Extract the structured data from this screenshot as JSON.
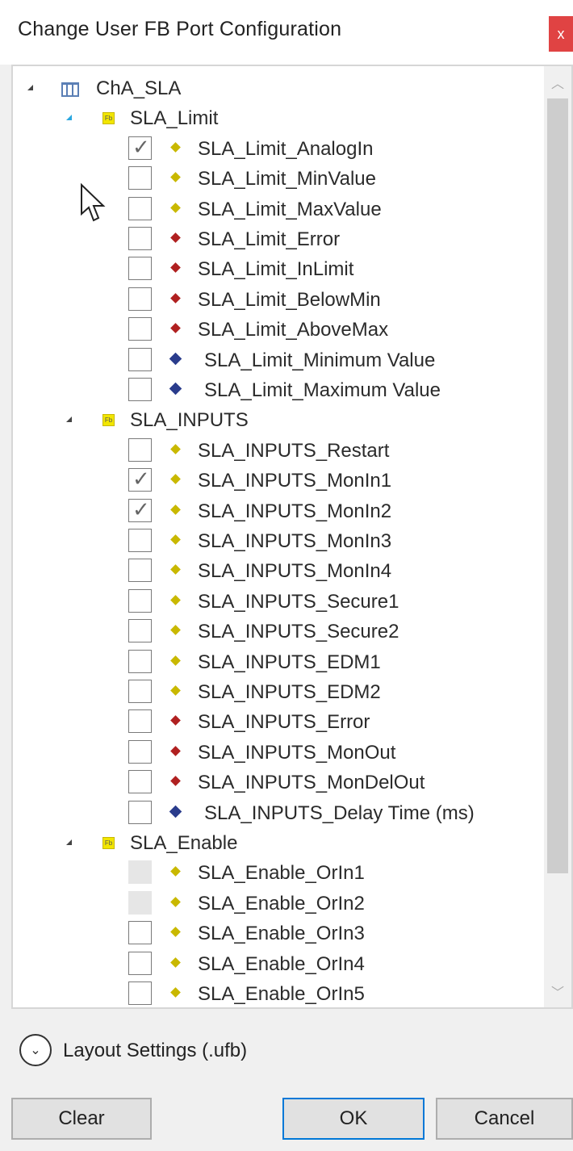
{
  "window": {
    "title": "Change User FB Port Configuration",
    "close_label": "x"
  },
  "tree": {
    "root": {
      "label": "ChA_SLA",
      "icon": "fb-table-icon"
    },
    "groups": [
      {
        "label": "SLA_Limit",
        "icon": "fb-icon",
        "items": [
          {
            "label": "SLA_Limit_AnalogIn",
            "checked": true,
            "disabled": false,
            "color": "#c9b800"
          },
          {
            "label": "SLA_Limit_MinValue",
            "checked": false,
            "disabled": false,
            "color": "#c9b800"
          },
          {
            "label": "SLA_Limit_MaxValue",
            "checked": false,
            "disabled": false,
            "color": "#c9b800"
          },
          {
            "label": "SLA_Limit_Error",
            "checked": false,
            "disabled": false,
            "color": "#b02020"
          },
          {
            "label": "SLA_Limit_InLimit",
            "checked": false,
            "disabled": false,
            "color": "#b02020"
          },
          {
            "label": "SLA_Limit_BelowMin",
            "checked": false,
            "disabled": false,
            "color": "#b02020"
          },
          {
            "label": "SLA_Limit_AboveMax",
            "checked": false,
            "disabled": false,
            "color": "#b02020"
          },
          {
            "label": "SLA_Limit_Minimum Value",
            "checked": false,
            "disabled": false,
            "color": "#2a3c8c"
          },
          {
            "label": "SLA_Limit_Maximum Value",
            "checked": false,
            "disabled": false,
            "color": "#2a3c8c"
          }
        ]
      },
      {
        "label": "SLA_INPUTS",
        "icon": "fb-icon",
        "items": [
          {
            "label": "SLA_INPUTS_Restart",
            "checked": false,
            "disabled": false,
            "color": "#c9b800"
          },
          {
            "label": "SLA_INPUTS_MonIn1",
            "checked": true,
            "disabled": false,
            "color": "#c9b800"
          },
          {
            "label": "SLA_INPUTS_MonIn2",
            "checked": true,
            "disabled": false,
            "color": "#c9b800"
          },
          {
            "label": "SLA_INPUTS_MonIn3",
            "checked": false,
            "disabled": false,
            "color": "#c9b800"
          },
          {
            "label": "SLA_INPUTS_MonIn4",
            "checked": false,
            "disabled": false,
            "color": "#c9b800"
          },
          {
            "label": "SLA_INPUTS_Secure1",
            "checked": false,
            "disabled": false,
            "color": "#c9b800"
          },
          {
            "label": "SLA_INPUTS_Secure2",
            "checked": false,
            "disabled": false,
            "color": "#c9b800"
          },
          {
            "label": "SLA_INPUTS_EDM1",
            "checked": false,
            "disabled": false,
            "color": "#c9b800"
          },
          {
            "label": "SLA_INPUTS_EDM2",
            "checked": false,
            "disabled": false,
            "color": "#c9b800"
          },
          {
            "label": "SLA_INPUTS_Error",
            "checked": false,
            "disabled": false,
            "color": "#b02020"
          },
          {
            "label": "SLA_INPUTS_MonOut",
            "checked": false,
            "disabled": false,
            "color": "#b02020"
          },
          {
            "label": "SLA_INPUTS_MonDelOut",
            "checked": false,
            "disabled": false,
            "color": "#b02020"
          },
          {
            "label": "SLA_INPUTS_Delay Time (ms)",
            "checked": false,
            "disabled": false,
            "color": "#2a3c8c"
          }
        ]
      },
      {
        "label": "SLA_Enable",
        "icon": "fb-icon",
        "items": [
          {
            "label": "SLA_Enable_OrIn1",
            "checked": false,
            "disabled": true,
            "color": "#c9b800"
          },
          {
            "label": "SLA_Enable_OrIn2",
            "checked": false,
            "disabled": true,
            "color": "#c9b800"
          },
          {
            "label": "SLA_Enable_OrIn3",
            "checked": false,
            "disabled": false,
            "color": "#c9b800"
          },
          {
            "label": "SLA_Enable_OrIn4",
            "checked": false,
            "disabled": false,
            "color": "#c9b800"
          },
          {
            "label": "SLA_Enable_OrIn5",
            "checked": false,
            "disabled": false,
            "color": "#c9b800"
          }
        ]
      }
    ]
  },
  "layout_settings": {
    "label": "Layout Settings (.ufb)",
    "icon": "chevron-down-circle-icon"
  },
  "buttons": {
    "clear": "Clear",
    "ok": "OK",
    "cancel": "Cancel"
  },
  "colors": {
    "input": "#c9b800",
    "output": "#b02020",
    "parameter": "#2a3c8c",
    "close": "#e04343",
    "accent": "#0078d7"
  }
}
